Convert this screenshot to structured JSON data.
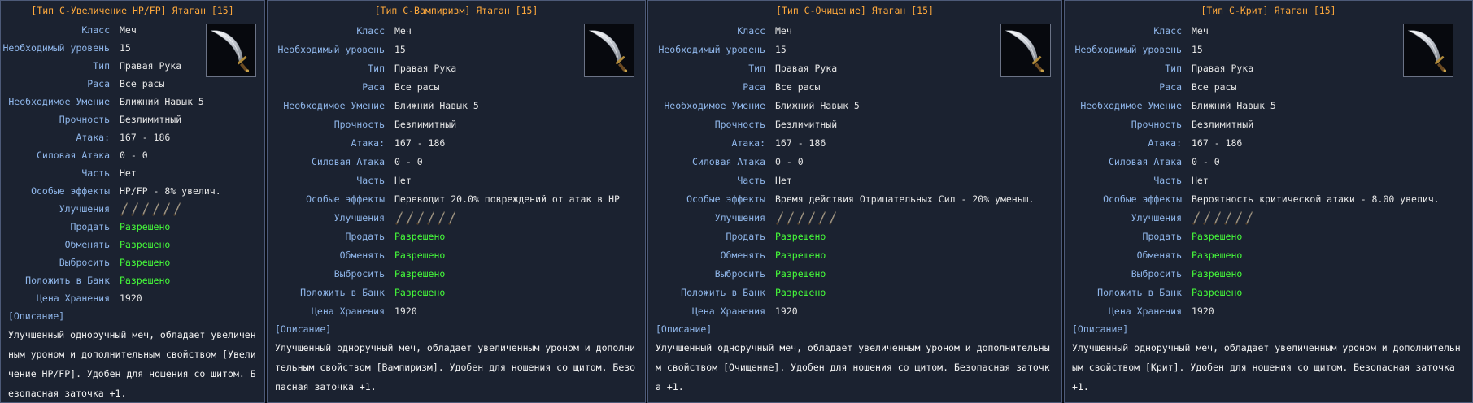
{
  "cards": [
    {
      "title": "[Тип С-Увеличение HP/FP] Ятаган [15]",
      "rows": {
        "class_label": "Класс",
        "class_value": "Меч",
        "level_label": "Необходимый уровень",
        "level_value": "15",
        "type_label": "Тип",
        "type_value": "Правая Рука",
        "race_label": "Раса",
        "race_value": "Все расы",
        "skill_label": "Необходимое Умение",
        "skill_value": "Ближний Навык 5",
        "durability_label": "Прочность",
        "durability_value": "Безлимитный",
        "attack_label": "Атака:",
        "attack_value": "167 - 186",
        "power_label": "Силовая Атака",
        "power_value": "0 - 0",
        "part_label": "Часть",
        "part_value": "Нет",
        "effects_label": "Особые эффекты",
        "effects_value": "HP/FP - 8% увелич.",
        "upgrades_label": "Улучшения",
        "sell_label": "Продать",
        "sell_value": "Разрешено",
        "trade_label": "Обменять",
        "trade_value": "Разрешено",
        "drop_label": "Выбросить",
        "drop_value": "Разрешено",
        "bank_label": "Положить в Банк",
        "bank_value": "Разрешено",
        "storage_label": "Цена Хранения",
        "storage_value": "1920"
      },
      "desc_head": "[Описание]",
      "desc": "Улучшенный одноручный меч, обладает увеличенным уроном и дополнительным свойством [Увеличение HP/FP]. Удобен для ношения со щитом. Безопасная заточка +1."
    },
    {
      "title": "[Тип С-Вампиризм] Ятаган [15]",
      "rows": {
        "class_label": "Класс",
        "class_value": "Меч",
        "level_label": "Необходимый уровень",
        "level_value": "15",
        "type_label": "Тип",
        "type_value": "Правая Рука",
        "race_label": "Раса",
        "race_value": "Все расы",
        "skill_label": "Необходимое Умение",
        "skill_value": "Ближний Навык 5",
        "durability_label": "Прочность",
        "durability_value": "Безлимитный",
        "attack_label": "Атака:",
        "attack_value": "167 - 186",
        "power_label": "Силовая Атака",
        "power_value": "0 - 0",
        "part_label": "Часть",
        "part_value": "Нет",
        "effects_label": "Особые эффекты",
        "effects_value": "Переводит 20.0% повреждений от атак в HP",
        "upgrades_label": "Улучшения",
        "sell_label": "Продать",
        "sell_value": "Разрешено",
        "trade_label": "Обменять",
        "trade_value": "Разрешено",
        "drop_label": "Выбросить",
        "drop_value": "Разрешено",
        "bank_label": "Положить в Банк",
        "bank_value": "Разрешено",
        "storage_label": "Цена Хранения",
        "storage_value": "1920"
      },
      "desc_head": "[Описание]",
      "desc": "Улучшенный одноручный меч, обладает увеличенным уроном и дополнительным свойством [Вампиризм]. Удобен для ношения со щитом. Безопасная заточка +1."
    },
    {
      "title": "[Тип С-Очищение] Ятаган [15]",
      "rows": {
        "class_label": "Класс",
        "class_value": "Меч",
        "level_label": "Необходимый уровень",
        "level_value": "15",
        "type_label": "Тип",
        "type_value": "Правая Рука",
        "race_label": "Раса",
        "race_value": "Все расы",
        "skill_label": "Необходимое Умение",
        "skill_value": "Ближний Навык 5",
        "durability_label": "Прочность",
        "durability_value": "Безлимитный",
        "attack_label": "Атака:",
        "attack_value": "167 - 186",
        "power_label": "Силовая Атака",
        "power_value": "0 - 0",
        "part_label": "Часть",
        "part_value": "Нет",
        "effects_label": "Особые эффекты",
        "effects_value": "Время действия Отрицательных Сил - 20% уменьш.",
        "upgrades_label": "Улучшения",
        "sell_label": "Продать",
        "sell_value": "Разрешено",
        "trade_label": "Обменять",
        "trade_value": "Разрешено",
        "drop_label": "Выбросить",
        "drop_value": "Разрешено",
        "bank_label": "Положить в Банк",
        "bank_value": "Разрешено",
        "storage_label": "Цена Хранения",
        "storage_value": "1920"
      },
      "desc_head": "[Описание]",
      "desc": "Улучшенный одноручный меч, обладает увеличенным уроном и дополнительным свойством [Очищение]. Удобен для ношения со щитом. Безопасная заточка +1."
    },
    {
      "title": "[Тип С-Крит] Ятаган [15]",
      "rows": {
        "class_label": "Класс",
        "class_value": "Меч",
        "level_label": "Необходимый уровень",
        "level_value": "15",
        "type_label": "Тип",
        "type_value": "Правая Рука",
        "race_label": "Раса",
        "race_value": "Все расы",
        "skill_label": "Необходимое Умение",
        "skill_value": "Ближний Навык 5",
        "durability_label": "Прочность",
        "durability_value": "Безлимитный",
        "attack_label": "Атака:",
        "attack_value": "167 - 186",
        "power_label": "Силовая Атака",
        "power_value": "0 - 0",
        "part_label": "Часть",
        "part_value": "Нет",
        "effects_label": "Особые эффекты",
        "effects_value": "Вероятность критической атаки - 8.00 увелич.",
        "upgrades_label": "Улучшения",
        "sell_label": "Продать",
        "sell_value": "Разрешено",
        "trade_label": "Обменять",
        "trade_value": "Разрешено",
        "drop_label": "Выбросить",
        "drop_value": "Разрешено",
        "bank_label": "Положить в Банк",
        "bank_value": "Разрешено",
        "storage_label": "Цена Хранения",
        "storage_value": "1920"
      },
      "desc_head": "[Описание]",
      "desc": "Улучшенный одноручный меч, обладает увеличенным уроном и дополнительным свойством [Крит]. Удобен для ношения со щитом. Безопасная заточка +1."
    }
  ],
  "colors": {
    "title": "#ffa93c",
    "label": "#8fb6ea",
    "value": "#e6e6e6",
    "allowed": "#46ff3a",
    "background": "#1b2230"
  },
  "icons": {
    "item": "scimitar-icon",
    "upgrade_slot": "upgrade-slot-icon"
  }
}
